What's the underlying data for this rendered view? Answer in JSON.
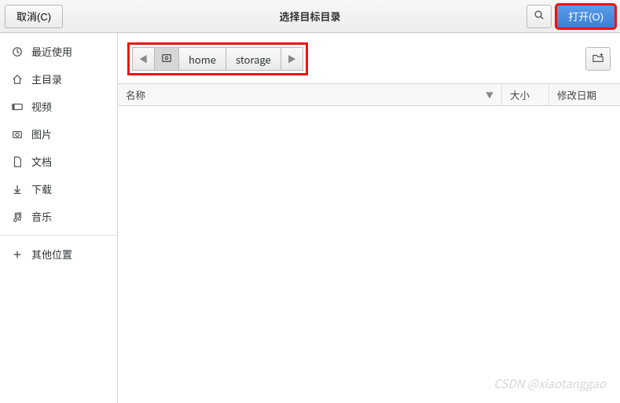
{
  "header": {
    "cancel_label": "取消(C)",
    "title": "选择目标目录",
    "open_label": "打开(O)"
  },
  "sidebar": {
    "items": [
      {
        "label": "最近使用",
        "icon": "recent-icon"
      },
      {
        "label": "主目录",
        "icon": "home-icon"
      },
      {
        "label": "视频",
        "icon": "video-icon"
      },
      {
        "label": "图片",
        "icon": "pictures-icon"
      },
      {
        "label": "文档",
        "icon": "documents-icon"
      },
      {
        "label": "下载",
        "icon": "downloads-icon"
      },
      {
        "label": "音乐",
        "icon": "music-icon"
      }
    ],
    "other_locations_label": "其他位置"
  },
  "pathbar": {
    "segments": [
      {
        "label": "home"
      },
      {
        "label": "storage"
      }
    ]
  },
  "columns": {
    "name": "名称",
    "size": "大小",
    "modified": "修改日期"
  },
  "watermark": "CSDN @xiaotanggao"
}
